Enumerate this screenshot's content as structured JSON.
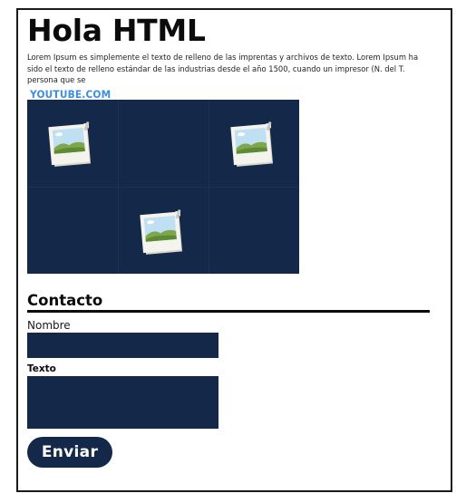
{
  "page": {
    "title": "Hola HTML",
    "intro_text": "Lorem Ipsum es simplemente el texto de relleno de las imprentas y archivos de texto. Lorem Ipsum ha sido el texto de relleno estándar de las industrias desde el año 1500, cuando un impresor (N. del T. persona que se",
    "youtube_link": "YOUTUBE.COM"
  },
  "gallery": {
    "background_color": "#14294a",
    "cells": [
      {
        "icon": "image-placeholder-icon",
        "has_image": true
      },
      {
        "icon": "",
        "has_image": false
      },
      {
        "icon": "image-placeholder-icon",
        "has_image": true
      },
      {
        "icon": "",
        "has_image": false
      },
      {
        "icon": "image-placeholder-icon",
        "has_image": true
      },
      {
        "icon": "",
        "has_image": false
      }
    ]
  },
  "contact": {
    "heading": "Contacto",
    "name_label": "Nombre",
    "name_value": "",
    "text_label": "Texto",
    "text_value": "",
    "submit_label": "Enviar"
  },
  "colors": {
    "dark_navy": "#14294a",
    "link_blue": "#3b8fd8",
    "text": "#0b0b0b"
  }
}
